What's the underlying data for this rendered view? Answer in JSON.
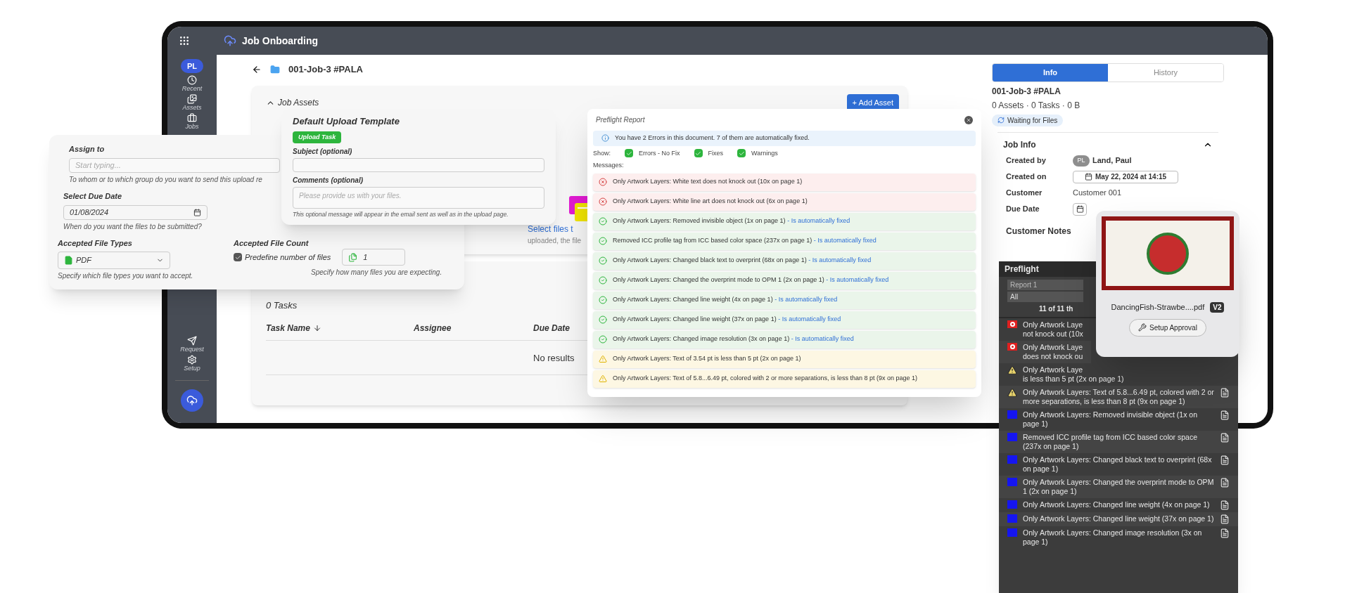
{
  "app_bar": {
    "title": "Job Onboarding"
  },
  "sidebar": {
    "avatar": "PL",
    "top_items": [
      "Recent",
      "Assets",
      "Jobs"
    ],
    "bottom_items": [
      "Request",
      "Setup"
    ]
  },
  "breadcrumb": {
    "title": "001-Job-3 #PALA"
  },
  "job_assets": {
    "title": "Job Assets",
    "expanded": true,
    "add_button": "+ Add Asset",
    "drop_zone": {
      "link": "Select files t",
      "hint": "uploaded, the file"
    }
  },
  "tasks": {
    "count": "0 Tasks",
    "columns": [
      {
        "label": "Task Name",
        "sorted": true
      },
      {
        "label": "Assignee",
        "sorted": false
      },
      {
        "label": "Due Date",
        "sorted": false
      }
    ],
    "empty": "No results"
  },
  "info_panel": {
    "tabs": [
      {
        "label": "Info",
        "selected": true
      },
      {
        "label": "History",
        "selected": false
      }
    ],
    "title": "001-Job-3 #PALA",
    "summary": "0 Assets · 0 Tasks · 0 B",
    "status": "Waiting for Files",
    "job_info": {
      "title": "Job Info",
      "expanded": true,
      "fields": [
        {
          "label": "Created by",
          "kind": "user",
          "avatar": "PL",
          "value": "Land, Paul"
        },
        {
          "label": "Created on",
          "kind": "date",
          "value": "May 22, 2024 at 14:15"
        },
        {
          "label": "Customer",
          "kind": "text",
          "value": "Customer 001"
        },
        {
          "label": "Due Date",
          "kind": "date"
        }
      ]
    },
    "customer_notes": "Customer Notes"
  },
  "assign_form": {
    "assign_to": {
      "label": "Assign to",
      "placeholder": "Start typing...",
      "hint": "To whom or to which group do you want to send this upload re"
    },
    "due_date": {
      "label": "Select Due Date",
      "value": "01/08/2024",
      "hint": "When do you want the files to be submitted?"
    },
    "file_types": {
      "label": "Accepted File Types",
      "value": "PDF",
      "hint": "Specify which file types you want to accept."
    },
    "file_count": {
      "label": "Accepted File Count",
      "checkbox": {
        "label": "Predefine number of files",
        "checked": true
      },
      "value": "1",
      "hint": "Specify how many files you are expecting."
    }
  },
  "upload_template": {
    "title": "Default Upload Template",
    "badge": "Upload Task",
    "subject": {
      "label": "Subject (optional)"
    },
    "comments": {
      "label": "Comments (optional)",
      "placeholder": "Please provide us with your files.",
      "hint": "This optional message will appear in the email sent as well as in the upload page."
    }
  },
  "preflight_report": {
    "title": "Preflight Report",
    "banner": "You have 2 Errors in this document. 7 of them are automatically fixed.",
    "show_label": "Show:",
    "filters": [
      {
        "label": "Errors - No Fix",
        "checked": true
      },
      {
        "label": "Fixes",
        "checked": true
      },
      {
        "label": "Warnings",
        "checked": true
      }
    ],
    "messages_label": "Messages:",
    "messages": [
      {
        "kind": "error",
        "text": "Only Artwork Layers: White text does not knock out (10x on page 1)"
      },
      {
        "kind": "error",
        "text": "Only Artwork Layers: White line art does not knock out (6x on page 1)"
      },
      {
        "kind": "fixed",
        "text": "Only Artwork Layers: Removed invisible object (1x on page 1)",
        "note": "- Is automatically fixed"
      },
      {
        "kind": "fixed",
        "text": "Removed ICC profile tag from ICC based color space (237x on page 1)",
        "note": "- Is automatically fixed"
      },
      {
        "kind": "fixed",
        "text": "Only Artwork Layers: Changed black text to overprint (68x on page 1)",
        "note": "- Is automatically fixed"
      },
      {
        "kind": "fixed",
        "text": "Only Artwork Layers: Changed the overprint mode to OPM 1 (2x on page 1)",
        "note": "- Is automatically fixed"
      },
      {
        "kind": "fixed",
        "text": "Only Artwork Layers: Changed line weight (4x on page 1)",
        "note": "- Is automatically fixed"
      },
      {
        "kind": "fixed",
        "text": "Only Artwork Layers: Changed line weight (37x on page 1)",
        "note": "- Is automatically fixed"
      },
      {
        "kind": "fixed",
        "text": "Only Artwork Layers: Changed image resolution (3x on page 1)",
        "note": "- Is automatically fixed"
      },
      {
        "kind": "warning",
        "text": "Only Artwork Layers: Text of 3.54 pt is less than 5 pt (2x on page 1)"
      },
      {
        "kind": "warning",
        "text": "Only Artwork Layers: Text of 5.8...6.49 pt, colored with 2 or more separations, is less than 8 pt (9x on page 1)"
      }
    ]
  },
  "preflight_panel": {
    "title": "Preflight",
    "report_select": "Report 1",
    "filter_select": "All",
    "count": "11 of 11 th",
    "rows": [
      {
        "kind": "error",
        "lines": [
          "Only Artwork Laye",
          "not knock out (10x"
        ],
        "report_icon": false
      },
      {
        "kind": "error",
        "lines": [
          "Only Artwork Laye",
          "does not knock ou"
        ],
        "report_icon": false
      },
      {
        "kind": "warning",
        "lines": [
          "Only Artwork Laye",
          "is less than 5 pt (2x on page 1)"
        ],
        "report_icon": false
      },
      {
        "kind": "warning",
        "text": "Only Artwork Layers: Text of 5.8...6.49 pt, colored with 2 or more separations, is less than 8 pt (9x on page 1)",
        "report_icon": true
      },
      {
        "kind": "fixed",
        "text": "Only Artwork Layers: Removed invisible object (1x on page 1)",
        "report_icon": true
      },
      {
        "kind": "fixed",
        "text": "Removed ICC profile tag from ICC based color space (237x on page 1)",
        "report_icon": true
      },
      {
        "kind": "fixed",
        "text": "Only Artwork Layers: Changed black text to overprint (68x on page 1)",
        "report_icon": true
      },
      {
        "kind": "fixed",
        "text": "Only Artwork Layers: Changed the overprint mode to OPM 1 (2x on page 1)",
        "report_icon": true
      },
      {
        "kind": "fixed",
        "text": "Only Artwork Layers: Changed line weight (4x on page 1)",
        "report_icon": true
      },
      {
        "kind": "fixed",
        "text": "Only Artwork Layers: Changed line weight (37x on page 1)",
        "report_icon": true
      },
      {
        "kind": "fixed",
        "text": "Only Artwork Layers: Changed image resolution (3x on page 1)",
        "report_icon": true
      }
    ]
  },
  "asset_card": {
    "file_name": "DancingFish-Strawbe....pdf",
    "version": "V2",
    "button": "Setup Approval"
  }
}
